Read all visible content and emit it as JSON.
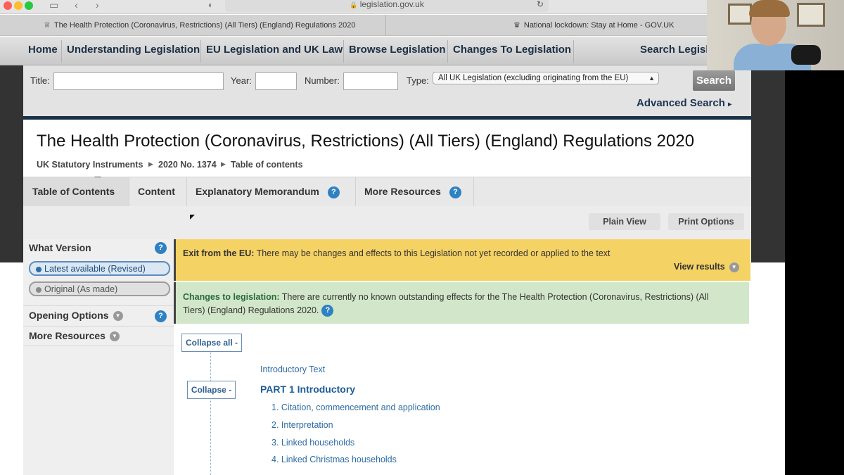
{
  "browser": {
    "url": "legislation.gov.uk",
    "tabs": [
      {
        "title": "The Health Protection (Coronavirus, Restrictions) (All Tiers) (England) Regulations 2020"
      },
      {
        "title": "National lockdown: Stay at Home - GOV.UK"
      }
    ]
  },
  "site_nav": {
    "items": [
      "Home",
      "Understanding Legislation",
      "EU Legislation and UK Law",
      "Browse Legislation",
      "Changes To Legislation"
    ],
    "search_label": "Search Legisla"
  },
  "search": {
    "title_label": "Title:",
    "year_label": "Year:",
    "number_label": "Number:",
    "type_label": "Type:",
    "type_value": "All UK Legislation (excluding originating from the EU)",
    "search_button": "Search",
    "advanced_search": "Advanced Search"
  },
  "document": {
    "title": "The Health Protection (Coronavirus, Restrictions) (All Tiers) (England) Regulations 2020",
    "breadcrumb": [
      "UK Statutory Instruments",
      "2020 No. 1374",
      "Table of contents"
    ]
  },
  "doc_tabs": [
    "Table of Contents",
    "Content",
    "Explanatory Memorandum",
    "More Resources"
  ],
  "toolbar": {
    "plain_view": "Plain View",
    "print_options": "Print Options"
  },
  "sidebar": {
    "what_version": "What Version",
    "latest": "Latest available (Revised)",
    "original": "Original (As made)",
    "opening_options": "Opening Options",
    "more_resources": "More Resources"
  },
  "notices": {
    "eu_title": "Exit from the EU:",
    "eu_text": "There may be changes and effects to this Legislation not yet recorded or applied to the text",
    "eu_link": "View results",
    "changes_title": "Changes to legislation:",
    "changes_text_1": "There are currently no known outstanding effects for the The Health Protection (Coronavirus, Restrictions) (All",
    "changes_text_2": "Tiers) (England) Regulations 2020."
  },
  "toc": {
    "collapse_all": "Collapse all -",
    "collapse": "Collapse -",
    "introductory_text": "Introductory Text",
    "part1": "PART 1 Introductory",
    "items": [
      "1. Citation, commencement and application",
      "2. Interpretation",
      "3. Linked households",
      "4. Linked Christmas households"
    ]
  },
  "colors": {
    "nav_text": "#1c2f44",
    "link": "#2d6ca2",
    "eu_notice": "#f5d264",
    "changes_notice": "#d2e7c9",
    "help_icon": "#2e81c2"
  }
}
